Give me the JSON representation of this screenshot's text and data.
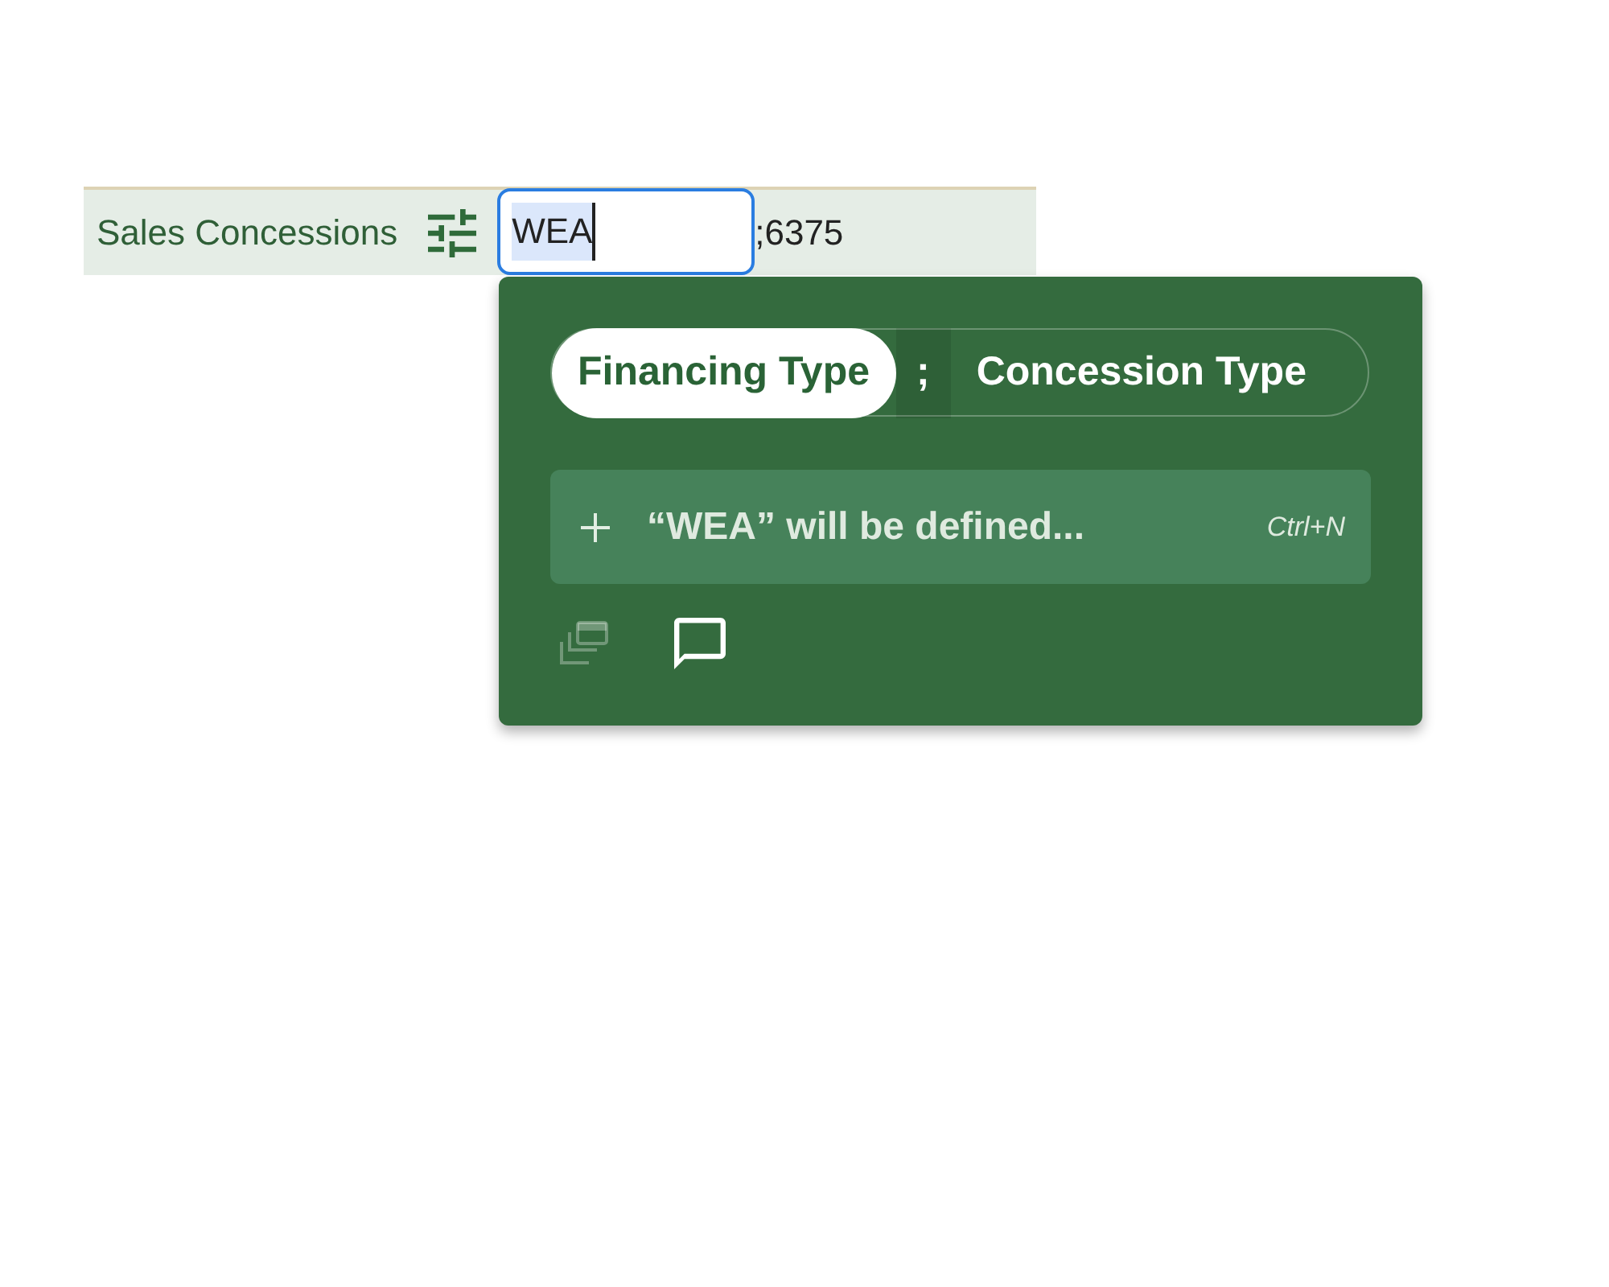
{
  "row": {
    "label": "Sales Concessions",
    "input": {
      "value": "WEA",
      "focused": true,
      "text_selected": true
    },
    "suffix": ";6375"
  },
  "popup": {
    "segments": [
      {
        "kind": "option",
        "label": "Financing Type",
        "selected": true
      },
      {
        "kind": "separator",
        "label": ";",
        "selected": false
      },
      {
        "kind": "option",
        "label": "Concession Type",
        "selected": false
      }
    ],
    "suggestion": {
      "text": "“WEA” will be defined...",
      "shortcut": "Ctrl+N"
    },
    "actions": [
      {
        "kind": "stack",
        "disabled": true
      },
      {
        "kind": "comment",
        "disabled": false
      }
    ]
  }
}
